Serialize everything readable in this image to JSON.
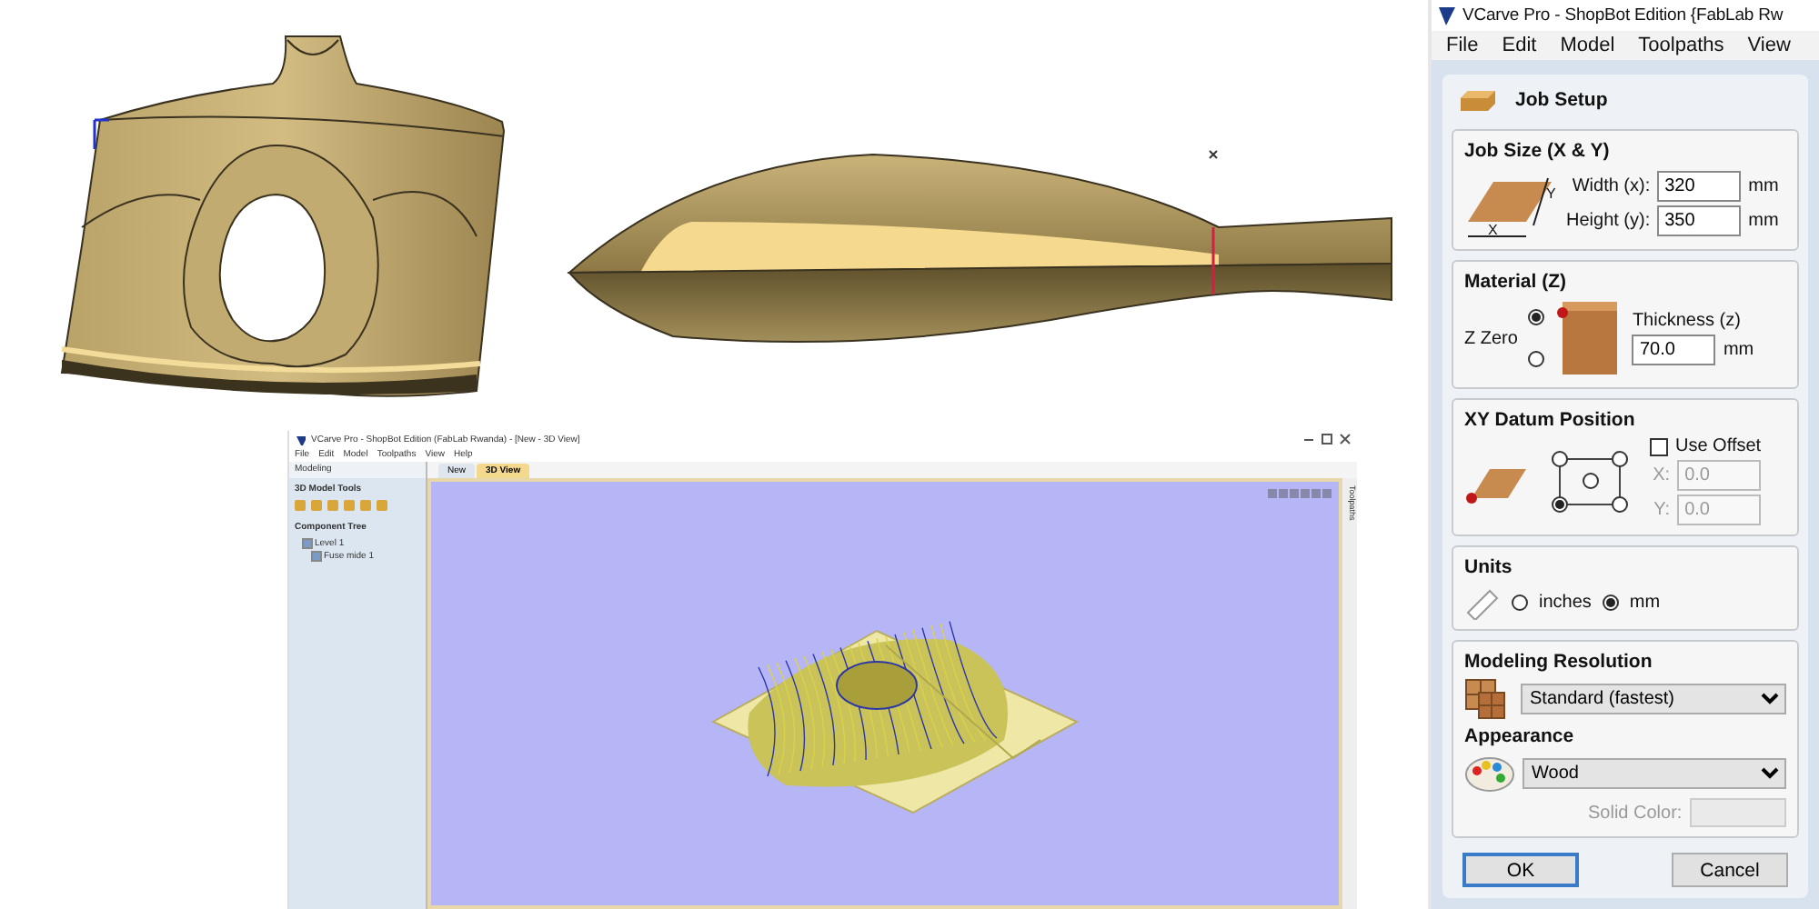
{
  "mini_app": {
    "title": "VCarve Pro - ShopBot Edition (FabLab Rwanda) - [New - 3D View]",
    "menu": [
      "File",
      "Edit",
      "Model",
      "Toolpaths",
      "View",
      "Help"
    ],
    "panel_title": "Modeling",
    "tools_title": "3D Model Tools",
    "tree_title": "Component Tree",
    "tree": [
      {
        "label": "Level 1",
        "checked": true,
        "children": [
          {
            "label": "Fuse mide 1",
            "checked": true
          }
        ]
      }
    ],
    "tabs": [
      {
        "label": "New",
        "selected": false
      },
      {
        "label": "3D View",
        "selected": true
      }
    ],
    "side_tab": "Toolpaths"
  },
  "panel": {
    "title": "VCarve Pro - ShopBot Edition {FabLab Rw",
    "menu": [
      "File",
      "Edit",
      "Model",
      "Toolpaths",
      "View"
    ],
    "heading": "Job Setup",
    "job_size": {
      "title": "Job Size (X & Y)",
      "axis_x": "X",
      "axis_y": "Y",
      "fields": [
        {
          "label": "Width (x):",
          "value": "320",
          "unit": "mm"
        },
        {
          "label": "Height (y):",
          "value": "350",
          "unit": "mm"
        }
      ]
    },
    "material": {
      "title": "Material (Z)",
      "z_zero_label": "Z Zero",
      "z_zero_options": [
        {
          "selected": true
        },
        {
          "selected": false
        }
      ],
      "thickness_label": "Thickness (z)",
      "thickness": "70.0",
      "unit": "mm"
    },
    "datum": {
      "title": "XY Datum Position",
      "points": [
        {
          "selected": false
        },
        {
          "selected": false
        },
        {
          "selected": false
        },
        {
          "selected": true
        },
        {
          "selected": false
        }
      ],
      "use_offset": {
        "label": "Use Offset",
        "checked": false
      },
      "offsets": [
        {
          "label": "X:",
          "value": "0.0",
          "disabled": true
        },
        {
          "label": "Y:",
          "value": "0.0",
          "disabled": true
        }
      ]
    },
    "units": {
      "title": "Units",
      "options": [
        {
          "label": "inches",
          "selected": false
        },
        {
          "label": "mm",
          "selected": true
        }
      ]
    },
    "resolution": {
      "title": "Modeling Resolution",
      "value": "Standard (fastest)"
    },
    "appearance": {
      "title": "Appearance",
      "value": "Wood",
      "solid_color_label": "Solid Color:",
      "solid_color_disabled": true
    },
    "buttons": [
      {
        "label": "OK",
        "default": true
      },
      {
        "label": "Cancel",
        "default": false
      }
    ]
  }
}
